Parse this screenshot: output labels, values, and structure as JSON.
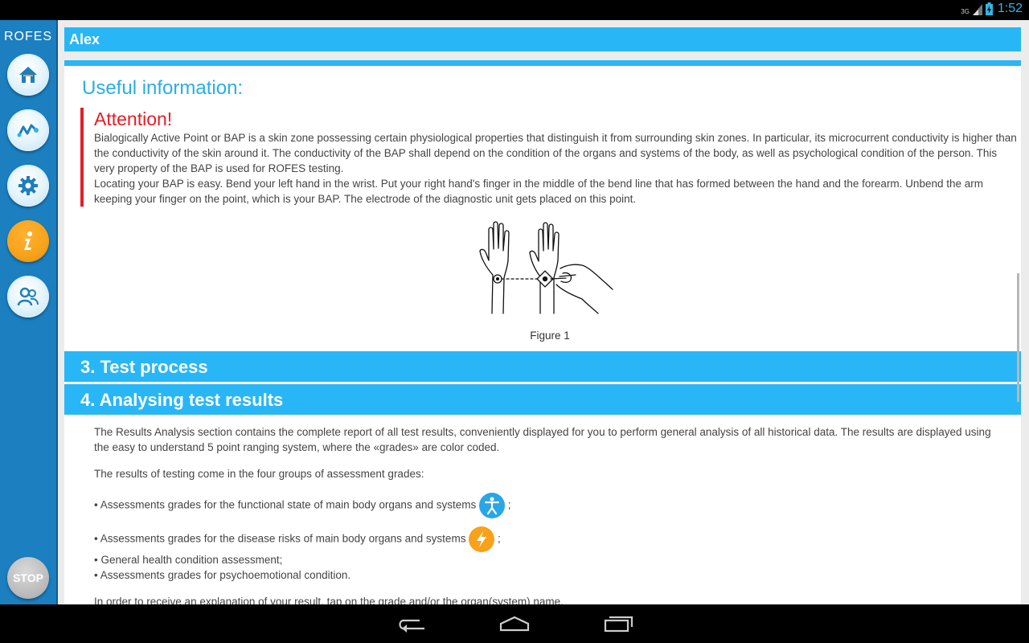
{
  "status": {
    "network": "3G",
    "time": "1:52"
  },
  "sidebar": {
    "brand": "ROFES",
    "items": [
      {
        "icon": "home-icon"
      },
      {
        "icon": "waves-icon"
      },
      {
        "icon": "gear-icon"
      },
      {
        "icon": "info-icon"
      },
      {
        "icon": "users-icon"
      }
    ],
    "stop_label": "STOP"
  },
  "header": {
    "user_name": "Alex"
  },
  "useful_info": {
    "title": "Useful information:",
    "attention_title": "Attention!",
    "paragraph1": "Bialogically Active Point or BAP is a skin zone possessing certain physiological properties that distinguish it from surrounding skin zones. In particular, its microcurrent conductivity is higher than the conductivity of the skin around it. The conductivity of the BAP shall depend on the condition of the organs and systems of the body, as well as psychological condition of the person. This very property of the BAP is used for ROFES testing.",
    "paragraph2": "Locating your BAP is easy. Bend your left hand in the wrist. Put your right hand's finger in the middle of the bend line that has formed between the hand and the forearm. Unbend the arm keeping your finger on the point, which is your BAP. The electrode of the diagnostic unit gets placed on this point.",
    "figure_caption": "Figure 1"
  },
  "sections": {
    "test_process": "3. Test process",
    "analysing": "4. Analysing test results"
  },
  "results": {
    "intro": "The Results Analysis section contains the complete report of all test results, conveniently displayed for you to perform general analysis of all historical data. The results are displayed using the easy to understand 5 point ranging system, where the «grades» are color coded.",
    "groups_intro": "The results of testing come in the four groups of assessment grades:",
    "item1": "• Assessments grades for the functional state of main body organs and systems",
    "item1_suffix": ";",
    "item2": "• Assessments grades for the disease risks of main body organs and systems",
    "item2_suffix": ";",
    "item3": "• General health condition assessment;",
    "item4": "• Assessments grades for psychoemotional condition.",
    "outro": "In order to receive an explanation of your result, tap on the grade and/or the organ(system) name."
  },
  "colors": {
    "accent": "#29b6f6",
    "sidebar": "#1b7fc0",
    "attention": "#e41e26",
    "active_button": "#f7a21a"
  }
}
